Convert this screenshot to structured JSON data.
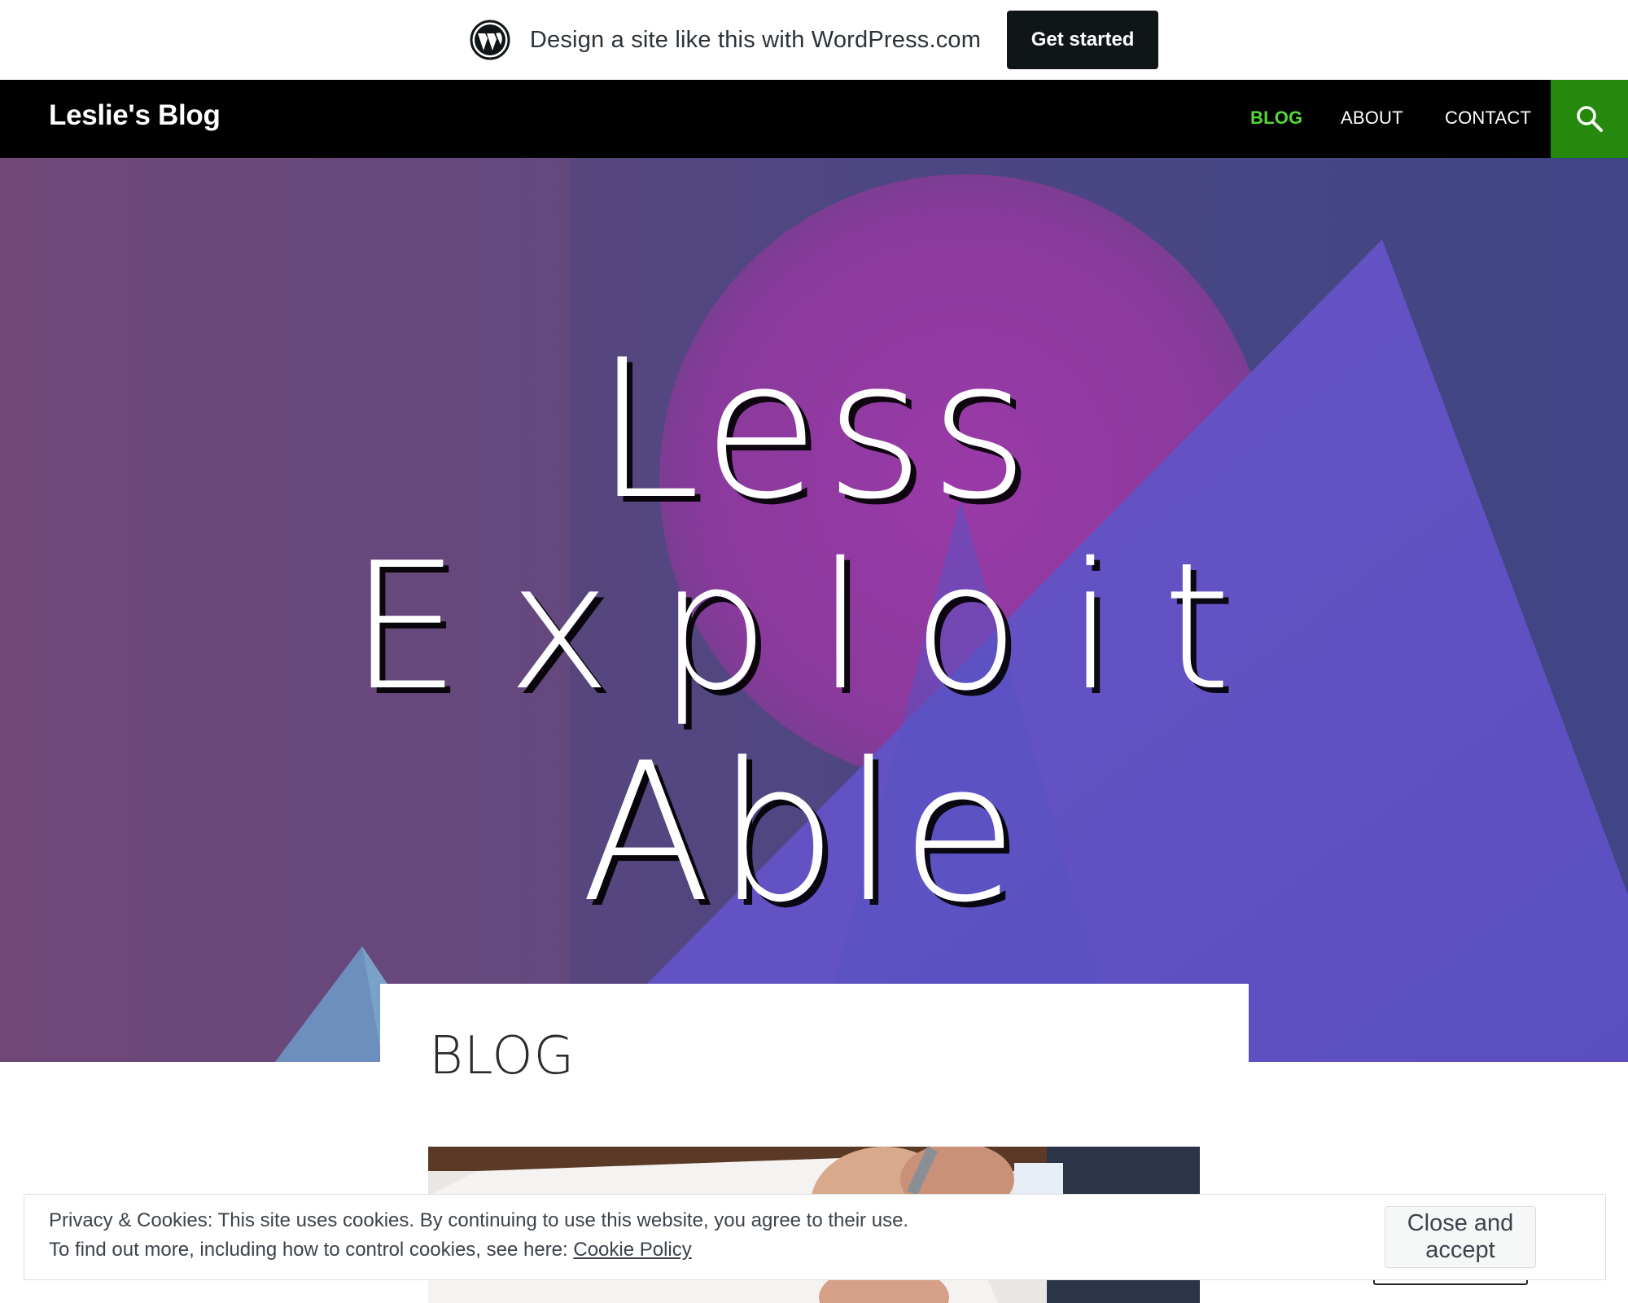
{
  "promo": {
    "text": "Design a site like this with WordPress.com",
    "cta_label": "Get started",
    "logo_icon": "wordpress-logo-icon"
  },
  "header": {
    "site_title": "Leslie's Blog",
    "nav": [
      {
        "label": "BLOG",
        "active": true
      },
      {
        "label": "ABOUT",
        "active": false
      },
      {
        "label": "CONTACT",
        "active": false
      }
    ],
    "search_icon": "search-icon"
  },
  "hero": {
    "lines": [
      "Less",
      "Exploit",
      "Able"
    ]
  },
  "content": {
    "page_title": "BLOG"
  },
  "cookie": {
    "line1": "Privacy & Cookies: This site uses cookies. By continuing to use this website, you agree to their use.",
    "line2_prefix": "To find out more, including how to control cookies, see here:",
    "link_text": "Cookie Policy",
    "button_label": "Close and accept"
  },
  "colors": {
    "header_bg": "#000000",
    "nav_active": "#55d737",
    "search_bg": "#24890d",
    "promo_button_bg": "#101517"
  }
}
